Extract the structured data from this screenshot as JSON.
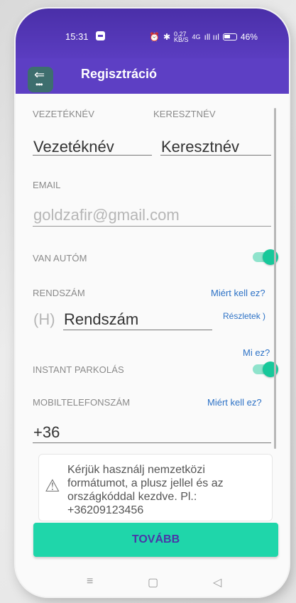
{
  "status": {
    "time": "15:31",
    "net_speed_top": "0,27",
    "net_speed_unit": "KB/S",
    "signal": "4G",
    "battery": "46%"
  },
  "appbar": {
    "title": "Regisztráció"
  },
  "form": {
    "lastname": {
      "label": "VEZETÉKNÉV",
      "value": "Vezetéknév"
    },
    "firstname": {
      "label": "KERESZTNÉV",
      "value": "Keresztnév"
    },
    "email": {
      "label": "EMAIL",
      "placeholder": "goldzafir@gmail.com"
    },
    "has_car": {
      "label": "VAN AUTÓM",
      "on": true
    },
    "plate": {
      "label": "RENDSZÁM",
      "prefix": "(H)",
      "value": "Rendszám",
      "why_link": "Miért kell ez?",
      "details_link": "Részletek )"
    },
    "instant": {
      "what_link": "Mi ez?",
      "label": "INSTANT PARKOLÁS",
      "on": true
    },
    "phone": {
      "label": "MOBILTELEFONSZÁM",
      "why_link": "Miért kell ez?",
      "value": "+36"
    }
  },
  "notice": {
    "icon": "warning-icon",
    "text": "Kérjük használj nemzetközi formátumot, a plusz jellel és az országkóddal kezdve. Pl.: +36209123456"
  },
  "continue_button": "TOVÁBB",
  "navbar": {
    "menu_icon": "≡",
    "home_icon": "▢",
    "back_icon": "◁"
  },
  "colors": {
    "primary": "#5d3fc4",
    "accent": "#1fd6aa",
    "link": "#2d72c6"
  }
}
